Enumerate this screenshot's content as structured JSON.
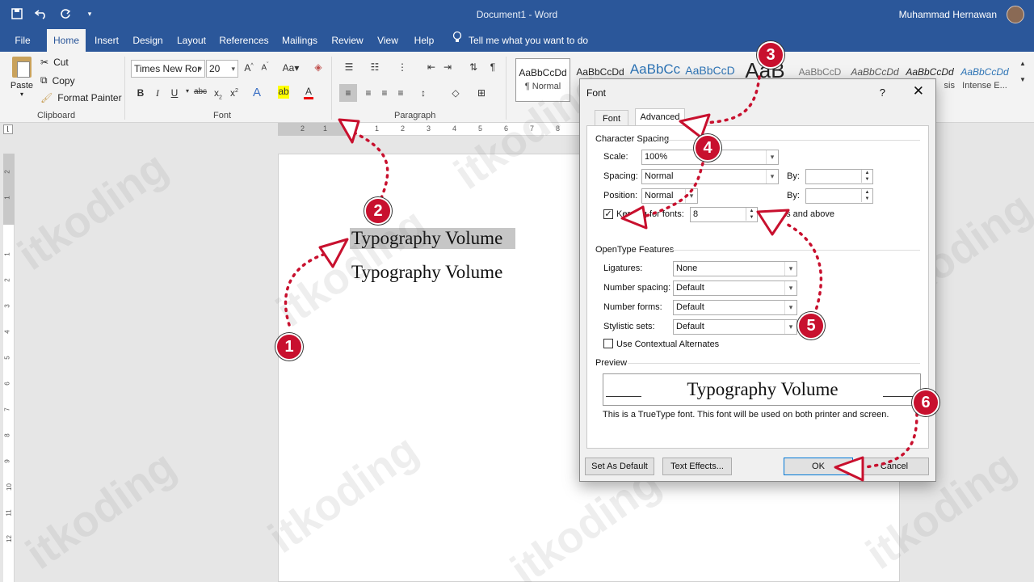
{
  "window": {
    "title": "Document1 - Word",
    "user": "Muhammad Hernawan"
  },
  "tabs": [
    "File",
    "Home",
    "Insert",
    "Design",
    "Layout",
    "References",
    "Mailings",
    "Review",
    "View",
    "Help"
  ],
  "tell_me": "Tell me what you want to do",
  "ribbon": {
    "clipboard": {
      "paste": "Paste",
      "cut": "Cut",
      "copy": "Copy",
      "format_painter": "Format Painter",
      "label": "Clipboard"
    },
    "font": {
      "name": "Times New Ror",
      "size": "20",
      "label": "Font"
    },
    "paragraph": {
      "label": "Paragraph"
    },
    "styles": [
      {
        "sample": "AaBbCcDd",
        "name": "¶ Normal"
      },
      {
        "sample": "AaBbCcDd",
        "name": ""
      },
      {
        "sample": "AaBbCc",
        "name": ""
      },
      {
        "sample": "AaBbCcD",
        "name": ""
      },
      {
        "sample": "AaB",
        "name": ""
      },
      {
        "sample": "AaBbCcD",
        "name": ""
      },
      {
        "sample": "AaBbCcDd",
        "name": ""
      },
      {
        "sample": "AaBbCcDd",
        "name": ""
      },
      {
        "sample": "AaBbCcDd",
        "name": "Intense E..."
      }
    ],
    "style_partial": "sis"
  },
  "document": {
    "line1": "Typography Volume",
    "line2": "Typography Volume"
  },
  "watermark": "itkoding",
  "dialog": {
    "title": "Font",
    "help": "?",
    "tabs": [
      "Font",
      "Advanced"
    ],
    "character_spacing": "Character Spacing",
    "scale_label": "Scale:",
    "scale_value": "100%",
    "spacing_label": "Spacing:",
    "spacing_value": "Normal",
    "position_label": "Position:",
    "position_value": "Normal",
    "by_label": "By:",
    "kerning_label": "Kerning for fonts:",
    "kerning_value": "8",
    "kerning_suffix": "Points and above",
    "opentype": "OpenType Features",
    "ligatures_label": "Ligatures:",
    "ligatures_value": "None",
    "number_spacing_label": "Number spacing:",
    "number_spacing_value": "Default",
    "number_forms_label": "Number forms:",
    "number_forms_value": "Default",
    "stylistic_sets_label": "Stylistic sets:",
    "stylistic_sets_value": "Default",
    "contextual_label": "Use Contextual Alternates",
    "preview_label": "Preview",
    "preview_text": "Typography Volume",
    "truetype_note": "This is a TrueType font. This font will be used on both printer and screen.",
    "set_default": "Set As Default",
    "text_effects": "Text Effects...",
    "ok": "OK",
    "cancel": "Cancel"
  },
  "steps": [
    "1",
    "2",
    "3",
    "4",
    "5",
    "6"
  ],
  "colors": {
    "title_blue": "#2b579a",
    "annotation_red": "#c8102e"
  }
}
